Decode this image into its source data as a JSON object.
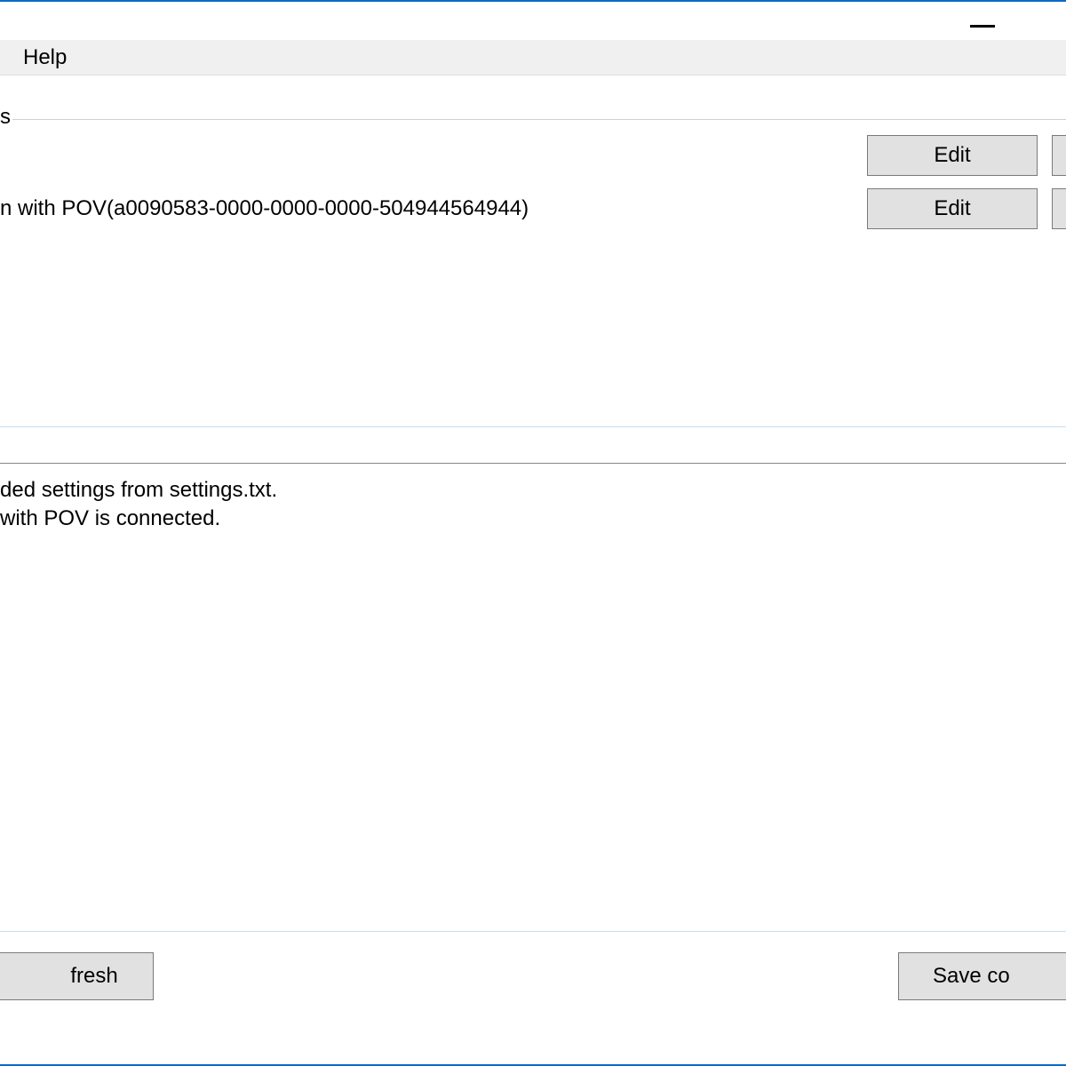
{
  "menubar": {
    "help": "Help"
  },
  "section": {
    "label_suffix": "s"
  },
  "devices": [
    {
      "label": "",
      "edit": "Edit"
    },
    {
      "label": "n with POV(a0090583-0000-0000-0000-504944564944)",
      "edit": "Edit"
    }
  ],
  "log": {
    "line1": "ded settings from settings.txt.",
    "line2": " with POV is connected."
  },
  "footer": {
    "refresh": "fresh",
    "save": "Save co"
  }
}
